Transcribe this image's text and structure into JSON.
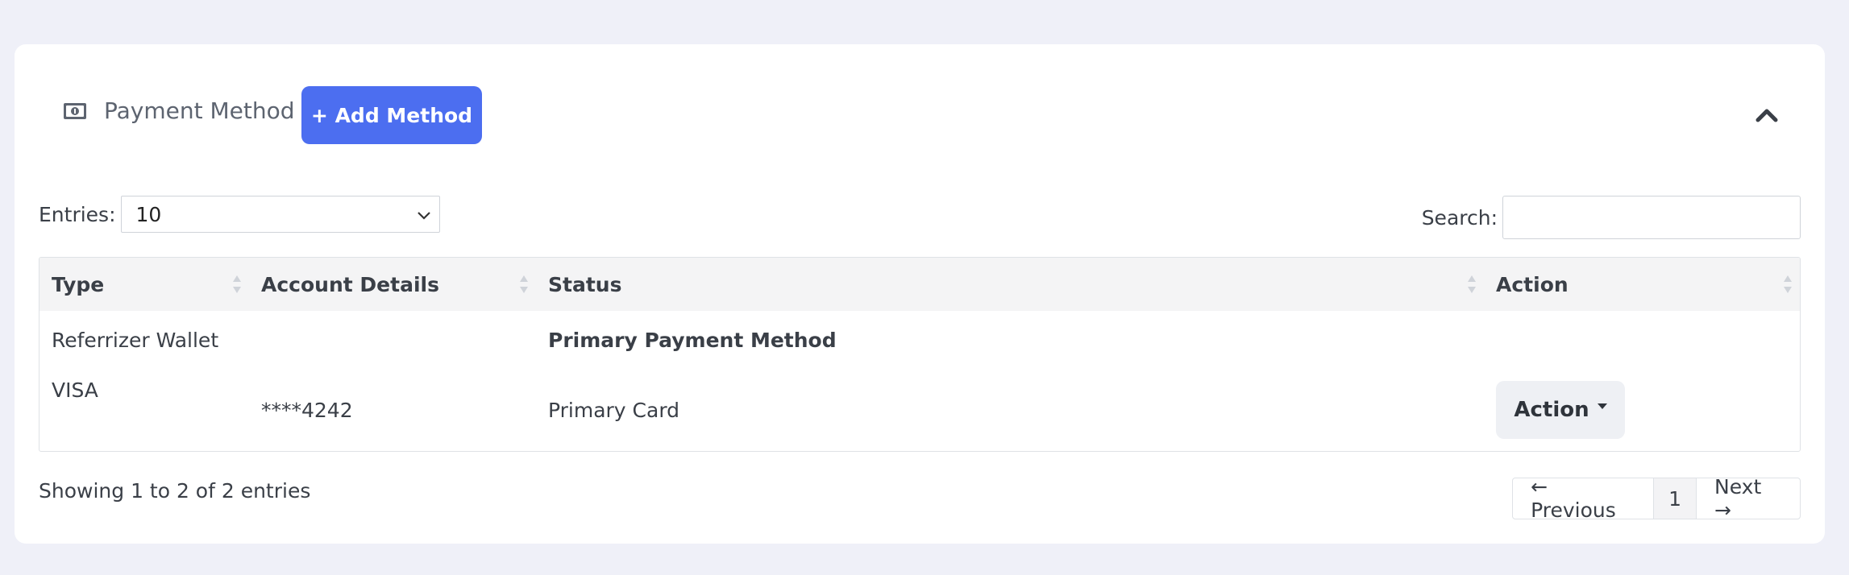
{
  "header": {
    "title": "Payment Method",
    "icon": "money-bill-icon",
    "add_button": "+ Add Method",
    "collapse_icon": "chevron-up-icon"
  },
  "controls": {
    "entries_label": "Entries:",
    "entries_value": "10",
    "search_label": "Search:",
    "search_value": ""
  },
  "table": {
    "columns": [
      "Type",
      "Account Details",
      "Status",
      "Action"
    ],
    "rows": [
      {
        "type": "Referrizer Wallet",
        "account": "",
        "status": "Primary Payment Method",
        "action": ""
      },
      {
        "type": "VISA",
        "account": "****4242",
        "status": "Primary Card",
        "action": "Action"
      }
    ]
  },
  "footer": {
    "info": "Showing 1 to 2 of 2 entries",
    "prev": "← Previous",
    "page": "1",
    "next": "Next →"
  },
  "colors": {
    "accent": "#4c6ef0",
    "background": "#eff0f8"
  }
}
